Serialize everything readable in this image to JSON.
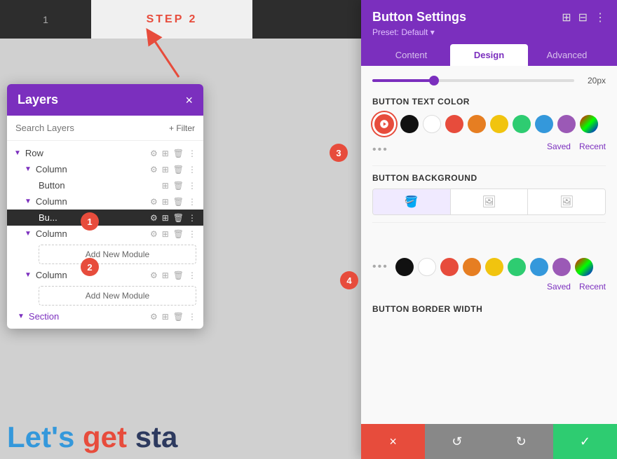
{
  "topBar": {
    "step1Label": "1",
    "step2Label": "STEP 2"
  },
  "layersPanel": {
    "title": "Layers",
    "closeLabel": "×",
    "searchPlaceholder": "Search Layers",
    "filterLabel": "+ Filter",
    "items": [
      {
        "name": "Row",
        "indent": 0,
        "hasChevron": true
      },
      {
        "name": "Column",
        "indent": 1,
        "hasChevron": true
      },
      {
        "name": "Button",
        "indent": 2,
        "hasChevron": false
      },
      {
        "name": "Column",
        "indent": 1,
        "hasChevron": true
      },
      {
        "name": "Bu...",
        "indent": 2,
        "active": true
      },
      {
        "name": "Column",
        "indent": 1,
        "hasChevron": true
      },
      {
        "name": "Add New Module",
        "indent": 2,
        "isAdd": true
      },
      {
        "name": "Column",
        "indent": 1,
        "hasChevron": true
      },
      {
        "name": "Add New Module",
        "indent": 2,
        "isAdd": true
      },
      {
        "name": "Section",
        "indent": 0,
        "hasChevron": true,
        "isSection": true
      }
    ]
  },
  "settingsPanel": {
    "title": "Button Settings",
    "preset": "Preset: Default ▾",
    "tabs": [
      "Content",
      "Design",
      "Advanced"
    ],
    "activeTab": "Design",
    "sliderValue": "20px",
    "sections": {
      "buttonTextColor": {
        "label": "Button Text Color",
        "colors": [
          "#111111",
          "#ffffff",
          "#e74c3c",
          "#e67e22",
          "#f1c40f",
          "#2ecc71",
          "#3498db",
          "#9b59b6",
          "#stripe"
        ]
      },
      "buttonBackground": {
        "label": "Button Background"
      },
      "buttonBorderWidth": {
        "label": "Button Border Width"
      }
    },
    "savedLabel": "Saved",
    "recentLabel": "Recent",
    "footer": {
      "cancelLabel": "×",
      "resetLabel": "↺",
      "redoLabel": "↻",
      "saveLabel": "✓"
    }
  },
  "badges": {
    "badge1": "1",
    "badge2": "2",
    "badge3": "3",
    "badge4": "4"
  },
  "bottomText": {
    "lets": "Let's ",
    "get": "get ",
    "sta": "sta"
  }
}
